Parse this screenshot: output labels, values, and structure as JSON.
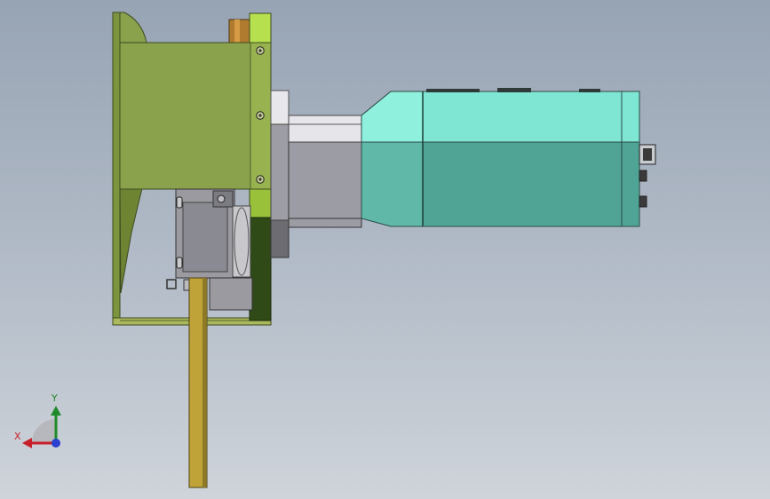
{
  "view": {
    "background_top": "#97a4b4",
    "background_bottom": "#cfd4da"
  },
  "colors": {
    "bracket_green": "#8aa24c",
    "bracket_shadow": "#5f7430",
    "housing_dark": "#2f4a17",
    "lime_block": "#b6e04e",
    "gearbox_grey": "#9a9aa0",
    "motor_teal_light": "#82eedc",
    "motor_teal_dark": "#4fa496",
    "shaft_brass": "#bfa339",
    "bronze_nut": "#b07b2e"
  },
  "triad": {
    "x_label": "X",
    "y_label": "Y",
    "x_color": "#c8202a",
    "y_color": "#1f8a2a",
    "z_color": "#2a3fd0"
  }
}
